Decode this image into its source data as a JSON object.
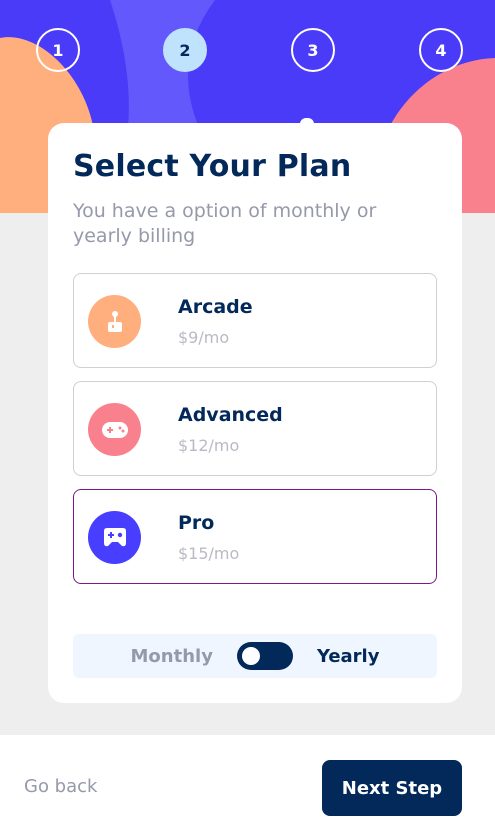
{
  "colors": {
    "hero_bg": "#4a3bf8",
    "hero_stripe": "#6258fb",
    "blob_left": "#ffaf7e",
    "blob_right": "#f9818e",
    "marine": "#022959",
    "step_active": "#bfe2fd",
    "selected_border": "#7a1a86"
  },
  "steps": [
    {
      "number": "1",
      "active": false
    },
    {
      "number": "2",
      "active": true
    },
    {
      "number": "3",
      "active": false
    },
    {
      "number": "4",
      "active": false
    }
  ],
  "header": {
    "title": "Select Your Plan",
    "subtitle": "You have a option of monthly or yearly billing"
  },
  "plans": [
    {
      "name": "Arcade",
      "price": "$9/mo",
      "icon": "arcade-joystick-icon",
      "color": "#ffaf7e",
      "selected": false
    },
    {
      "name": "Advanced",
      "price": "$12/mo",
      "icon": "gamepad-icon",
      "color": "#f9818e",
      "selected": false
    },
    {
      "name": "Pro",
      "price": "$15/mo",
      "icon": "controller-icon",
      "color": "#483eff",
      "selected": true
    }
  ],
  "billing": {
    "monthly_label": "Monthly",
    "yearly_label": "Yearly",
    "selected": "Monthly"
  },
  "footer": {
    "back_label": "Go back",
    "next_label": "Next Step"
  }
}
